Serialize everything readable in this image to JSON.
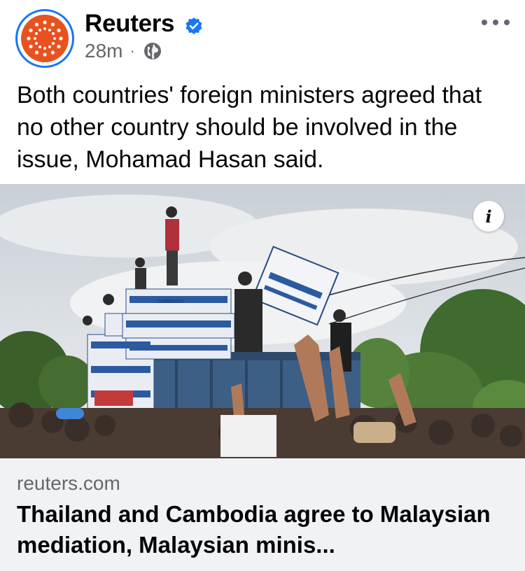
{
  "post": {
    "page_name": "Reuters",
    "time": "28m",
    "separator": "·",
    "icons": {
      "avatar": "reuters-logo-icon",
      "verified": "verified-badge-icon",
      "audience": "globe-icon",
      "more": "more-horizontal-icon",
      "info": "info-icon"
    },
    "text": "Both countries' foreign ministers agreed that no other country should be involved in the issue, Mohamad Hasan said.",
    "info_label": "i"
  },
  "link": {
    "domain": "reuters.com",
    "title": "Thailand and Cambodia agree to Malaysian mediation, Malaysian minis..."
  },
  "photo": {
    "box_label": "CAMBODIA"
  },
  "colors": {
    "brand_orange": "#e8521f",
    "facebook_blue": "#1877f2",
    "secondary_text": "#65676b",
    "link_card_bg": "#f0f2f5"
  }
}
